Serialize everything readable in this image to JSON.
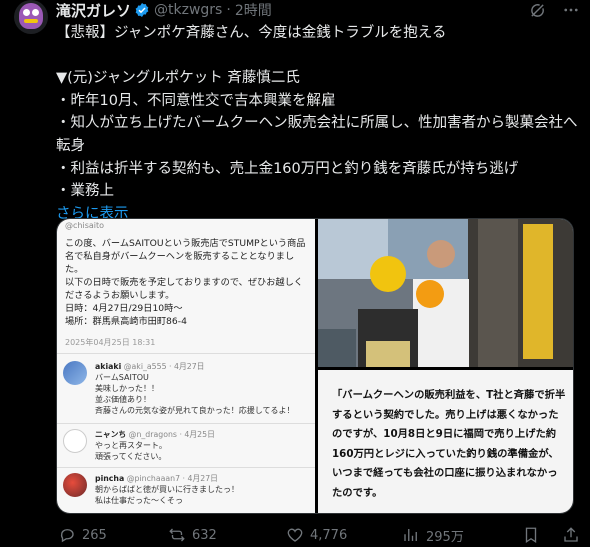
{
  "tweet": {
    "author": {
      "name": "滝沢ガレソ",
      "handle": "@tkzwgrs",
      "separator": "·",
      "time": "2時間"
    },
    "body": {
      "line1": "【悲報】ジャンポケ斉藤さん、今度は金銭トラブルを抱える",
      "line2": "▼(元)ジャングルポケット 斉藤慎二氏",
      "line3": "・昨年10月、不同意性交で吉本興業を解雇",
      "line4": "・知人が立ち上げたバームクーヘン販売会社に所属し、性加害者から製菓会社へ転身",
      "line5": "・利益は折半する契約も、売上金160万円と釣り銭を斉藤氏が持ち逃げ",
      "line6": "・業務上",
      "show_more": "さらに表示"
    },
    "media": {
      "left_panel": {
        "handle": "@chisaito",
        "body": "この度、バームSAITOUという販売店でSTUMPという商品名で私自身がバームクーヘンを販売することとなりました。\n以下の日時で販売を予定しておりますので、ぜひお越しくださるようお願いします。\n日時：4月27日/29日10時〜\n場所：群馬県高崎市田町86-4",
        "date": "2025年04月25日 18:31",
        "replies": [
          {
            "name": "akiaki",
            "handle": "@aki_a555 · 4月27日",
            "text": "バームSAITOU\n美味しかった！！\n並ぶ価値あり！\n斉藤さんの元気な姿が見れて良かった！応援してるよ！"
          },
          {
            "name": "ニャンち",
            "handle": "@n_dragons · 4月25日",
            "text": "やっと再スタート。\n頑張ってください。"
          },
          {
            "name": "pincha",
            "handle": "@pinchaaan7 · 4月27日",
            "text": "朝からばばと徳が買いに行きましたっ！\n私は仕事だった～くそっ"
          }
        ]
      },
      "right_bottom_panel": {
        "text": "「バームクーヘンの販売利益を、T社と斉藤で折半するという契約でした。売り上げは悪くなかったのですが、10月8日と9日に福岡で売り上げた約160万円とレジに入っていた釣り銭の準備金が、いつまで経っても会社の口座に振り込まれなかったのです。"
      }
    },
    "actions": {
      "replies": "265",
      "reposts": "632",
      "likes": "4,776",
      "views": "295万"
    }
  },
  "colors": {
    "background": "#000000",
    "text": "#e7e9ea",
    "muted": "#71767b",
    "link": "#1d9bf0",
    "verified": "#1d9bf0"
  },
  "icons": [
    "grok-icon",
    "more-icon",
    "verified-icon",
    "reply-icon",
    "repost-icon",
    "like-icon",
    "views-icon",
    "bookmark-icon",
    "share-icon"
  ]
}
